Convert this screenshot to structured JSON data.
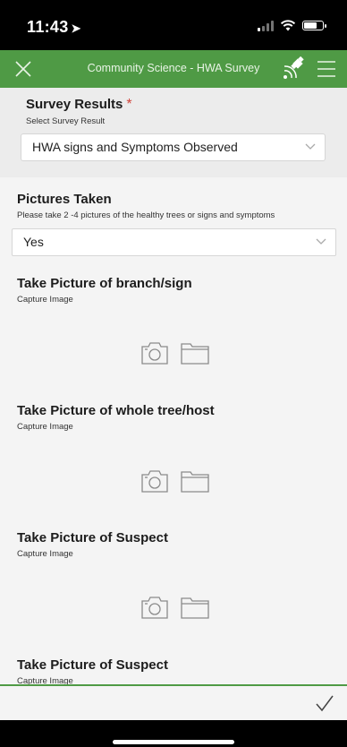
{
  "status_bar": {
    "time": "11:43",
    "location_glyph": "➤",
    "battery_level": 0.8
  },
  "header": {
    "title": "Community Science - HWA Survey"
  },
  "survey_results": {
    "title": "Survey Results",
    "required_mark": "*",
    "hint": "Select Survey Result",
    "value": "HWA signs and Symptoms Observed"
  },
  "pictures_taken": {
    "title": "Pictures Taken",
    "hint": "Please take 2 -4 pictures of the healthy trees or signs and symptoms",
    "value": "Yes"
  },
  "image_questions": [
    {
      "title": "Take Picture of branch/sign",
      "hint": "Capture Image"
    },
    {
      "title": "Take Picture of whole tree/host",
      "hint": "Capture Image"
    },
    {
      "title": "Take Picture of Suspect",
      "hint": "Capture Image"
    },
    {
      "title": "Take Picture of Suspect",
      "hint": "Capture Image"
    }
  ],
  "colors": {
    "header_green": "#4f9a45",
    "required_red": "#d0433a",
    "icon_gray": "#8a8a8a"
  }
}
